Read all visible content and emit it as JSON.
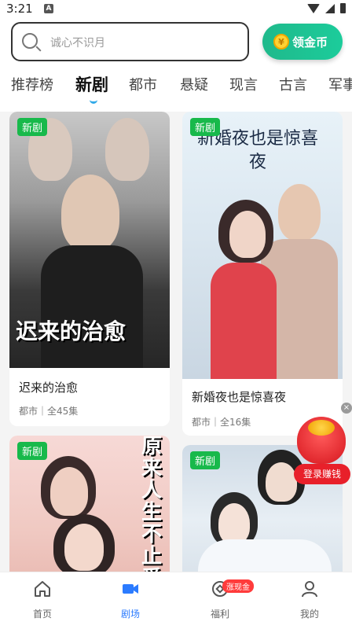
{
  "status_bar": {
    "time": "3:21",
    "notif_glyph": "A"
  },
  "search": {
    "placeholder": "诚心不识月",
    "icon": "search-icon"
  },
  "coins_button": {
    "label": "领金币",
    "coin_glyph": "¥",
    "accent": "#1fb98b"
  },
  "tabs": [
    {
      "label": "推荐榜"
    },
    {
      "label": "新剧"
    },
    {
      "label": "都市"
    },
    {
      "label": "悬疑"
    },
    {
      "label": "现言"
    },
    {
      "label": "古言"
    },
    {
      "label": "军事"
    }
  ],
  "active_tab_index": 1,
  "dramas": [
    {
      "badge": "新剧",
      "poster_text": "迟来的治愈",
      "title": "迟来的治愈",
      "meta": "都市｜全45集"
    },
    {
      "badge": "新剧",
      "poster_text": "新婚夜也是惊喜夜",
      "title": "新婚夜也是惊喜夜",
      "meta": "都市｜全16集"
    },
    {
      "badge": "新剧",
      "poster_text": "原来人生不止爱"
    },
    {
      "badge": "新剧"
    }
  ],
  "promo": {
    "label": "登录赚钱",
    "close_glyph": "×"
  },
  "bottom_nav": {
    "items": [
      {
        "label": "首页",
        "icon": "home-icon"
      },
      {
        "label": "剧场",
        "icon": "video-icon"
      },
      {
        "label": "福利",
        "icon": "gift-icon"
      },
      {
        "label": "我的",
        "icon": "user-icon"
      }
    ],
    "badge": "涨现金"
  }
}
